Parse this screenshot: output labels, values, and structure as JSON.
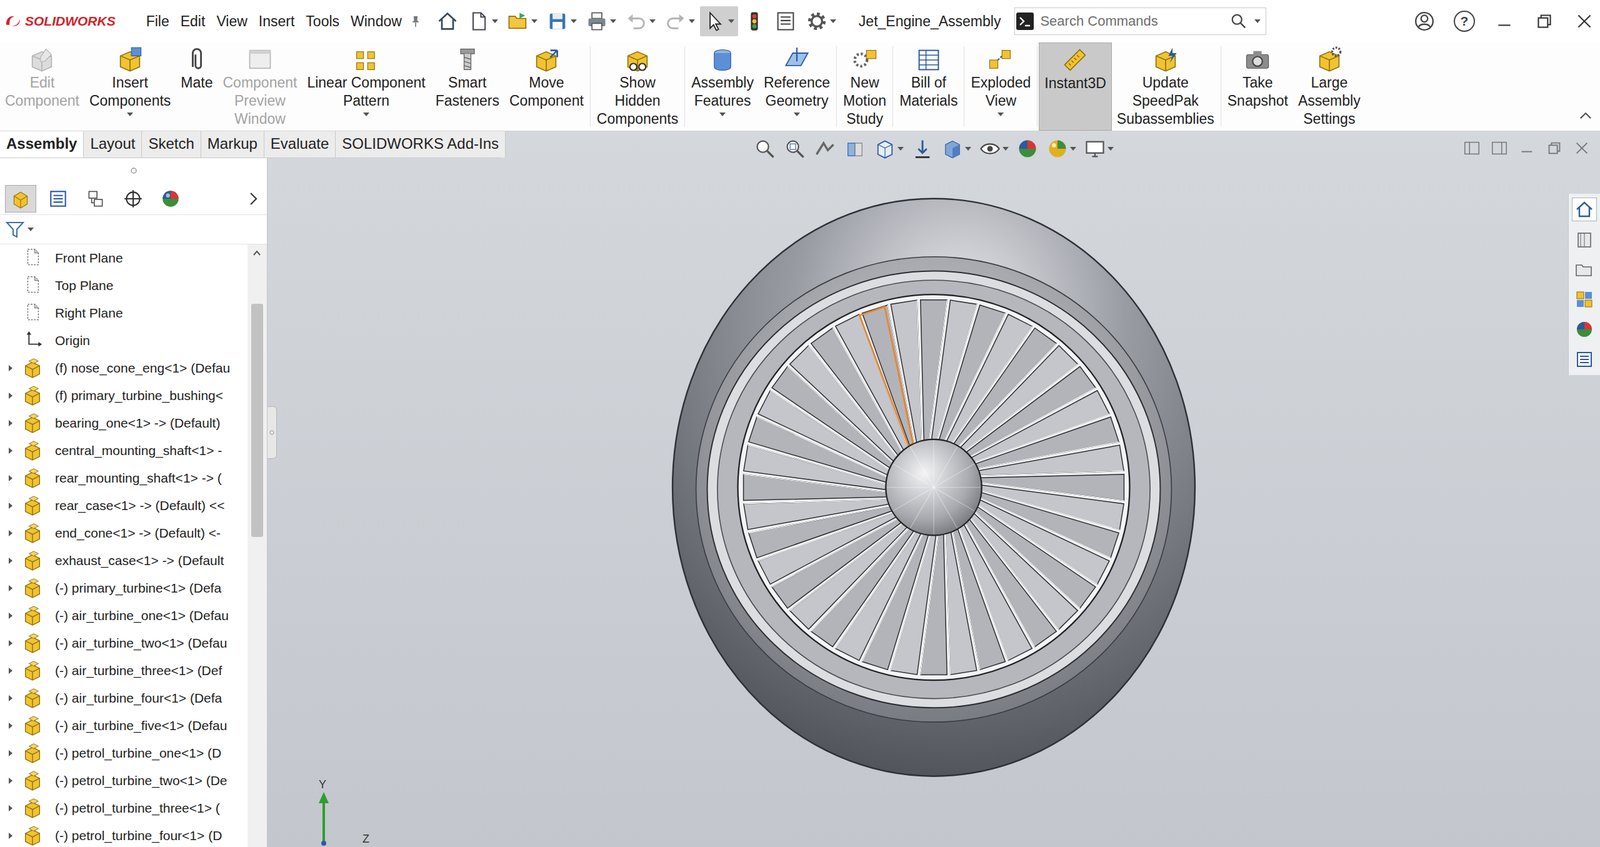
{
  "app": {
    "logo": "SOLIDWORKS",
    "document_title": "Jet_Engine_Assembly",
    "select_tool_selected": true,
    "help_icon": "?"
  },
  "menu": [
    {
      "label": "File"
    },
    {
      "label": "Edit"
    },
    {
      "label": "View"
    },
    {
      "label": "Insert"
    },
    {
      "label": "Tools"
    },
    {
      "label": "Window"
    }
  ],
  "search": {
    "placeholder": "Search Commands"
  },
  "ribbon": [
    {
      "lines": [
        "Edit",
        "Component"
      ],
      "disabled": true,
      "dropdown": false,
      "selected": false
    },
    {
      "lines": [
        "Insert",
        "Components"
      ],
      "disabled": false,
      "dropdown": true,
      "selected": false
    },
    {
      "lines": [
        "Mate"
      ],
      "disabled": false,
      "dropdown": false,
      "selected": false
    },
    {
      "lines": [
        "Component",
        "Preview",
        "Window"
      ],
      "disabled": true,
      "dropdown": false,
      "selected": false
    },
    {
      "lines": [
        "Linear Component",
        "Pattern"
      ],
      "disabled": false,
      "dropdown": true,
      "selected": false
    },
    {
      "lines": [
        "Smart",
        "Fasteners"
      ],
      "disabled": false,
      "dropdown": false,
      "selected": false
    },
    {
      "lines": [
        "Move",
        "Component"
      ],
      "disabled": false,
      "dropdown": false,
      "selected": false
    },
    {
      "lines": [
        "Show",
        "Hidden",
        "Components"
      ],
      "disabled": false,
      "dropdown": false,
      "selected": false
    },
    {
      "lines": [
        "Assembly",
        "Features"
      ],
      "disabled": false,
      "dropdown": true,
      "selected": false
    },
    {
      "lines": [
        "Reference",
        "Geometry"
      ],
      "disabled": false,
      "dropdown": true,
      "selected": false
    },
    {
      "lines": [
        "New",
        "Motion",
        "Study"
      ],
      "disabled": false,
      "dropdown": false,
      "selected": false
    },
    {
      "lines": [
        "Bill of",
        "Materials"
      ],
      "disabled": false,
      "dropdown": false,
      "selected": false
    },
    {
      "lines": [
        "Exploded",
        "View"
      ],
      "disabled": false,
      "dropdown": true,
      "selected": false
    },
    {
      "lines": [
        "Instant3D"
      ],
      "disabled": false,
      "dropdown": false,
      "selected": true
    },
    {
      "lines": [
        "Update",
        "SpeedPak",
        "Subassemblies"
      ],
      "disabled": false,
      "dropdown": false,
      "selected": false
    },
    {
      "lines": [
        "Take",
        "Snapshot"
      ],
      "disabled": false,
      "dropdown": false,
      "selected": false
    },
    {
      "lines": [
        "Large",
        "Assembly",
        "Settings"
      ],
      "disabled": false,
      "dropdown": false,
      "selected": false
    }
  ],
  "tabs": [
    {
      "label": "Assembly",
      "selected": true
    },
    {
      "label": "Layout",
      "selected": false
    },
    {
      "label": "Sketch",
      "selected": false
    },
    {
      "label": "Markup",
      "selected": false
    },
    {
      "label": "Evaluate",
      "selected": false
    },
    {
      "label": "SOLIDWORKS Add-Ins",
      "selected": false
    }
  ],
  "panel_tabs": [
    {
      "selected": true
    },
    {
      "selected": false
    },
    {
      "selected": false
    },
    {
      "selected": false
    },
    {
      "selected": false
    }
  ],
  "tree": {
    "items": [
      {
        "label": "Front Plane",
        "kind": "plane",
        "expandable": false,
        "expanded": false
      },
      {
        "label": "Top Plane",
        "kind": "plane",
        "expandable": false,
        "expanded": false
      },
      {
        "label": "Right Plane",
        "kind": "plane",
        "expandable": false,
        "expanded": false
      },
      {
        "label": "Origin",
        "kind": "origin",
        "expandable": false,
        "expanded": false
      },
      {
        "label": "(f) nose_cone_eng<1> (Defau",
        "kind": "part",
        "expandable": true,
        "expanded": false
      },
      {
        "label": "(f) primary_turbine_bushing<",
        "kind": "part",
        "expandable": true,
        "expanded": false
      },
      {
        "label": "bearing_one<1> -> (Default)",
        "kind": "part",
        "expandable": true,
        "expanded": false
      },
      {
        "label": "central_mounting_shaft<1> -",
        "kind": "part",
        "expandable": true,
        "expanded": false
      },
      {
        "label": "rear_mounting_shaft<1> -> (",
        "kind": "part",
        "expandable": true,
        "expanded": false
      },
      {
        "label": "rear_case<1> -> (Default) <<",
        "kind": "part",
        "expandable": true,
        "expanded": false
      },
      {
        "label": "end_cone<1> -> (Default) <-",
        "kind": "part",
        "expandable": true,
        "expanded": false
      },
      {
        "label": "exhaust_case<1> -> (Default",
        "kind": "part",
        "expandable": true,
        "expanded": false
      },
      {
        "label": "(-) primary_turbine<1> (Defa",
        "kind": "part",
        "expandable": true,
        "expanded": false
      },
      {
        "label": "(-) air_turbine_one<1> (Defau",
        "kind": "part",
        "expandable": true,
        "expanded": false
      },
      {
        "label": "(-) air_turbine_two<1> (Defau",
        "kind": "part",
        "expandable": true,
        "expanded": false
      },
      {
        "label": "(-) air_turbine_three<1> (Def",
        "kind": "part",
        "expandable": true,
        "expanded": false
      },
      {
        "label": "(-) air_turbine_four<1> (Defa",
        "kind": "part",
        "expandable": true,
        "expanded": false
      },
      {
        "label": "(-) air_turbine_five<1> (Defau",
        "kind": "part",
        "expandable": true,
        "expanded": false
      },
      {
        "label": "(-) petrol_turbine_one<1> (D",
        "kind": "part",
        "expandable": true,
        "expanded": false
      },
      {
        "label": "(-) petrol_turbine_two<1> (De",
        "kind": "part",
        "expandable": true,
        "expanded": false
      },
      {
        "label": "(-) petrol_turbine_three<1> (",
        "kind": "part",
        "expandable": true,
        "expanded": false
      },
      {
        "label": "(-) petrol_turbine_four<1> (D",
        "kind": "part",
        "expandable": true,
        "expanded": false
      }
    ],
    "scroll": {
      "offset": 0.07,
      "level": 0.4
    }
  },
  "viewport": {
    "blade_highlighted": true
  },
  "triad": {
    "y": "Y",
    "z": "Z"
  }
}
